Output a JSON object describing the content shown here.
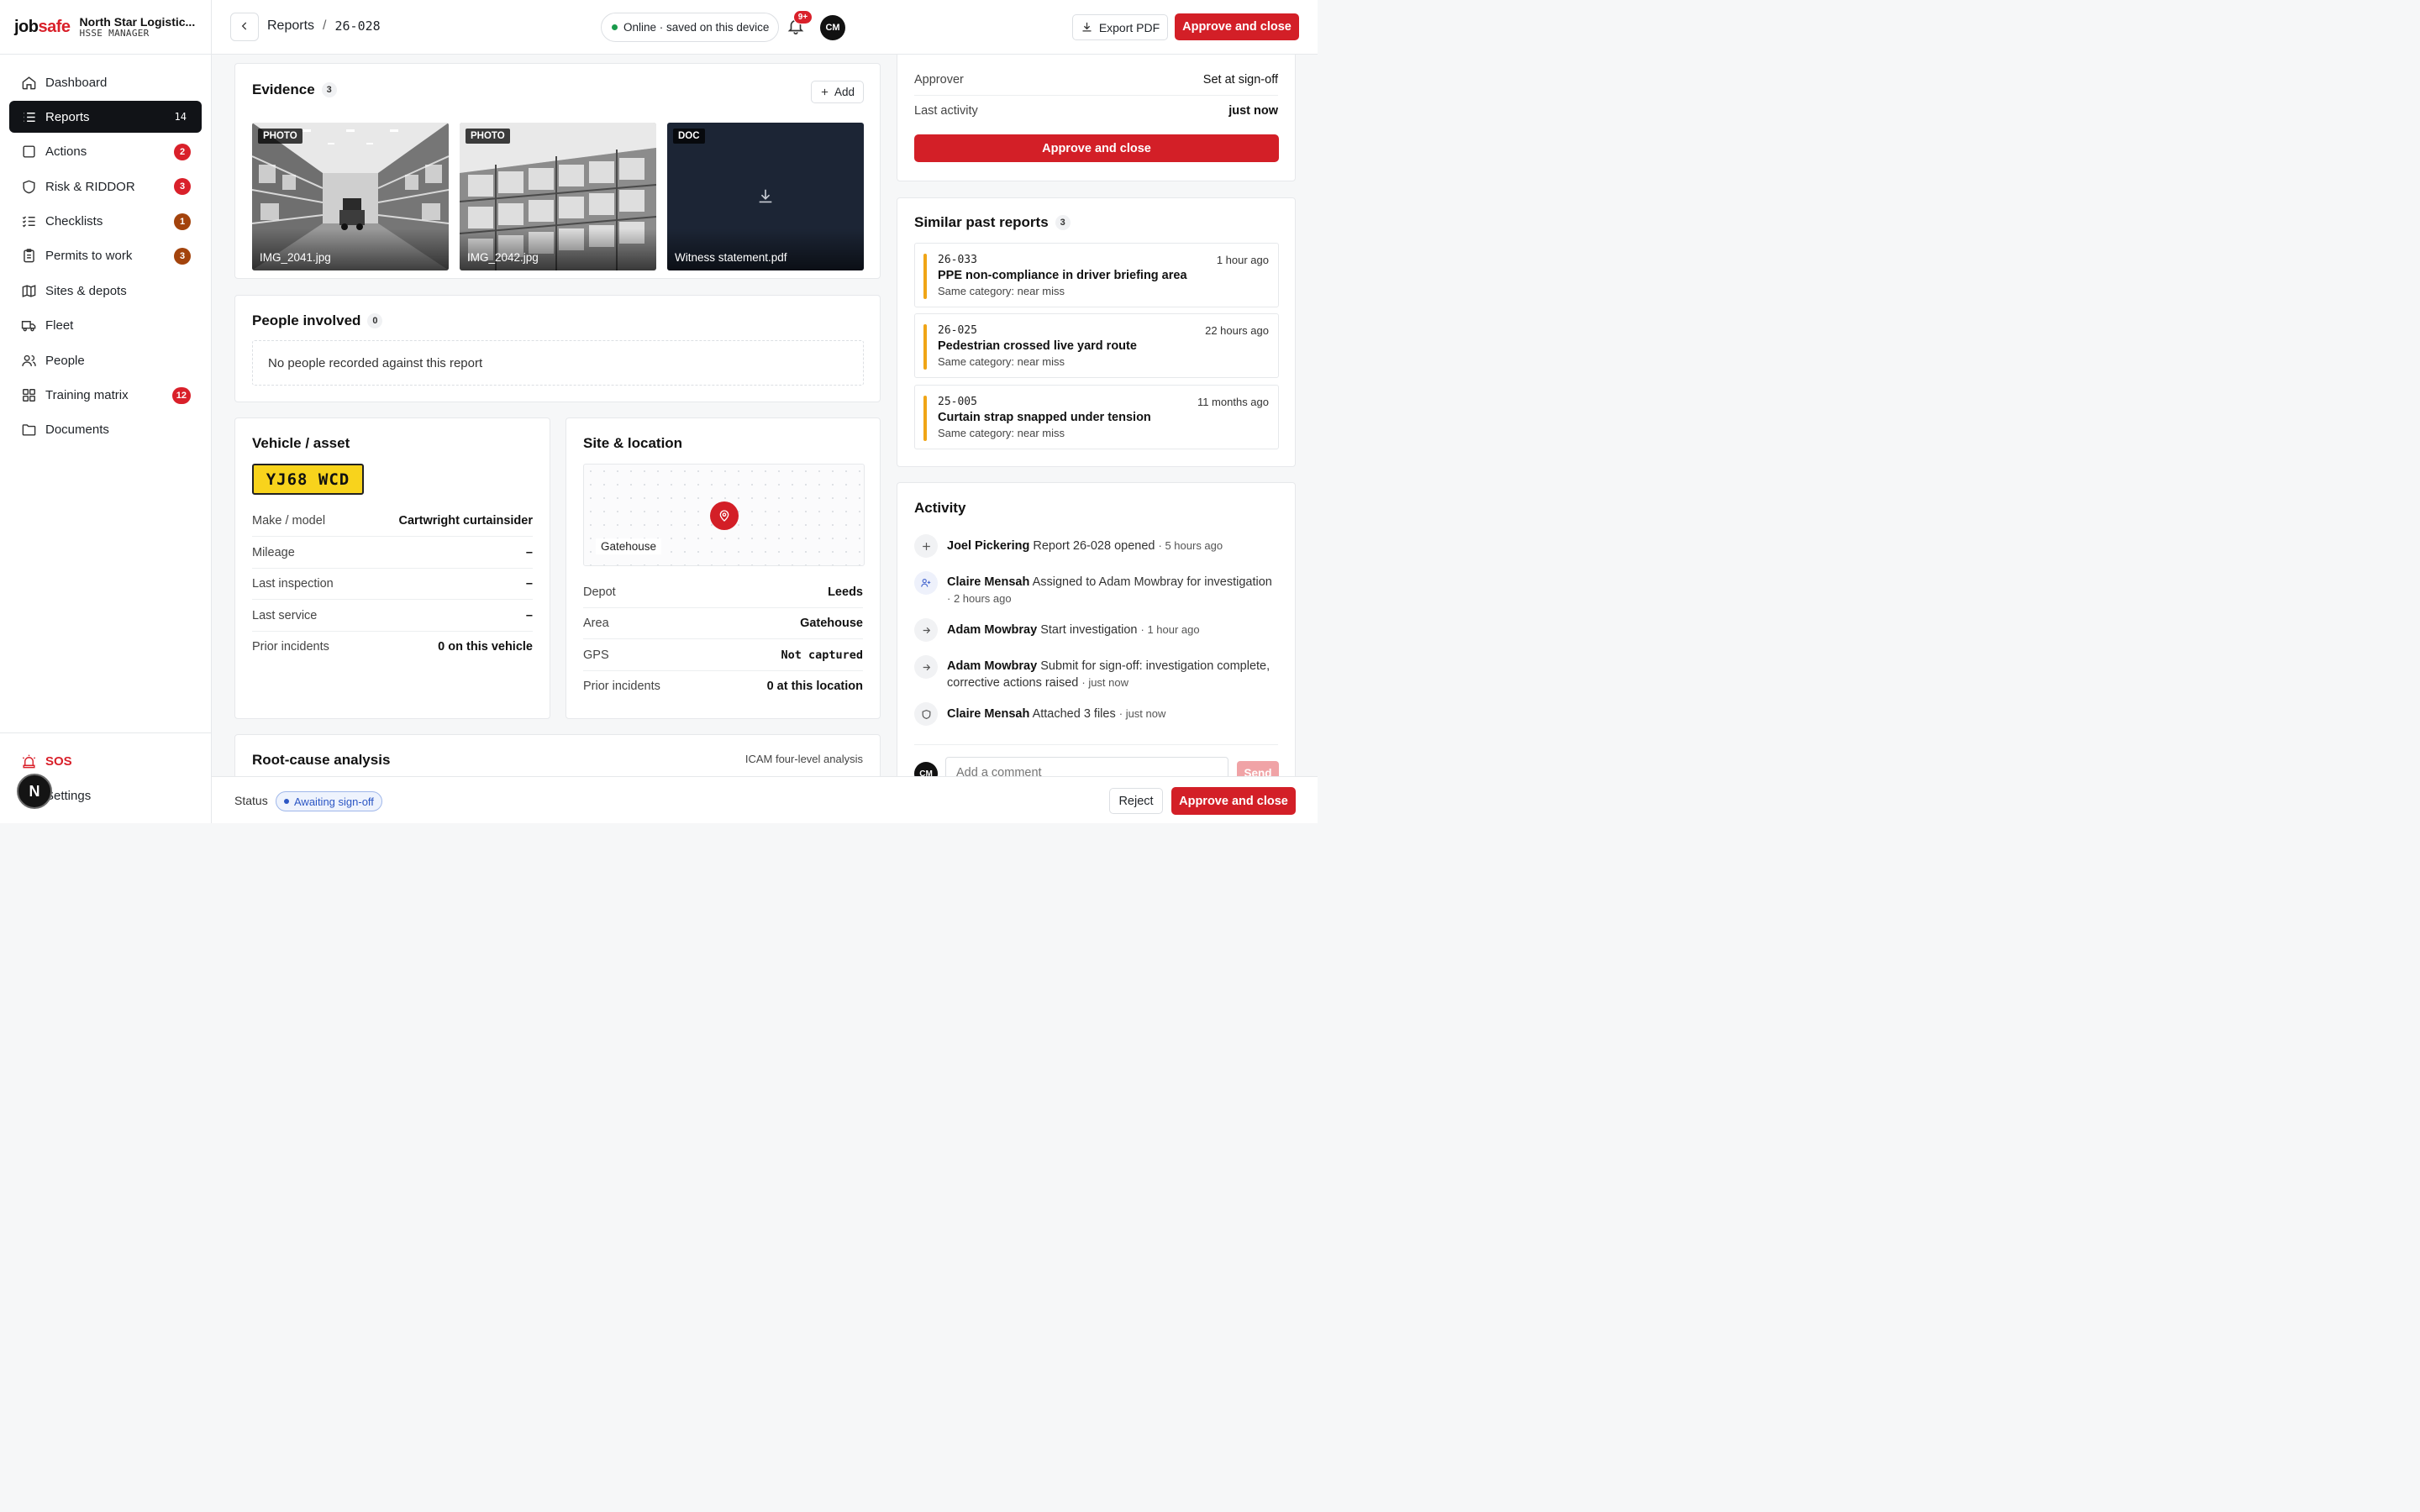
{
  "brand": {
    "logo_main": "job",
    "logo_accent": "safe",
    "org_name": "North Star Logistic...",
    "org_role": "HSSE MANAGER"
  },
  "nav": [
    {
      "label": "Dashboard",
      "icon": "home-icon",
      "badge": ""
    },
    {
      "label": "Reports",
      "icon": "list-icon",
      "badge": "14",
      "active": true
    },
    {
      "label": "Actions",
      "icon": "square-icon",
      "badge": "2"
    },
    {
      "label": "Risk & RIDDOR",
      "icon": "shield-icon",
      "badge": "3"
    },
    {
      "label": "Checklists",
      "icon": "checklist-icon",
      "badge": "1"
    },
    {
      "label": "Permits to work",
      "icon": "clipboard-icon",
      "badge": "3"
    },
    {
      "label": "Sites & depots",
      "icon": "map-icon",
      "badge": ""
    },
    {
      "label": "Fleet",
      "icon": "truck-icon",
      "badge": ""
    },
    {
      "label": "People",
      "icon": "people-icon",
      "badge": ""
    },
    {
      "label": "Training matrix",
      "icon": "grid-icon",
      "badge": "12"
    },
    {
      "label": "Documents",
      "icon": "folder-icon",
      "badge": ""
    }
  ],
  "sidebar_bottom": {
    "sos": "SOS",
    "settings": "Settings",
    "fab": "N"
  },
  "topbar": {
    "crumb_section": "Reports",
    "crumb_sep": "/",
    "crumb_id": "26-028",
    "status": "Online · saved on this device",
    "bell_badge": "9+",
    "avatar": "CM",
    "export": "Export PDF",
    "approve": "Approve and close"
  },
  "evidence": {
    "title": "Evidence",
    "count": "3",
    "add": "Add",
    "tiles": [
      {
        "kind": "PHOTO",
        "name": "IMG_2041.jpg"
      },
      {
        "kind": "PHOTO",
        "name": "IMG_2042.jpg"
      },
      {
        "kind": "DOC",
        "name": "Witness statement.pdf"
      }
    ]
  },
  "people": {
    "title": "People involved",
    "count": "0",
    "empty": "No people recorded against this report"
  },
  "vehicle": {
    "title": "Vehicle / asset",
    "plate": "YJ68 WCD",
    "rows": [
      {
        "k": "Make / model",
        "v": "Cartwright curtainsider"
      },
      {
        "k": "Mileage",
        "v": "–"
      },
      {
        "k": "Last inspection",
        "v": "–"
      },
      {
        "k": "Last service",
        "v": "–"
      },
      {
        "k": "Prior incidents",
        "v": "0 on this vehicle"
      }
    ]
  },
  "site": {
    "title": "Site & location",
    "map_label": "Gatehouse",
    "rows": [
      {
        "k": "Depot",
        "v": "Leeds"
      },
      {
        "k": "Area",
        "v": "Gatehouse"
      },
      {
        "k": "GPS",
        "v": "Not captured"
      },
      {
        "k": "Prior incidents",
        "v": "0 at this location"
      }
    ]
  },
  "rca": {
    "title": "Root-cause analysis",
    "method": "ICAM four-level analysis"
  },
  "summary": {
    "rows": [
      {
        "k": "Approver",
        "v": "Set at sign-off"
      },
      {
        "k": "Last activity",
        "v": "just now"
      }
    ],
    "approve": "Approve and close"
  },
  "similar": {
    "title": "Similar past reports",
    "count": "3",
    "items": [
      {
        "id": "26-033",
        "time": "1 hour ago",
        "title": "PPE non-compliance in driver briefing area",
        "category": "Same category: near miss"
      },
      {
        "id": "26-025",
        "time": "22 hours ago",
        "title": "Pedestrian crossed live yard route",
        "category": "Same category: near miss"
      },
      {
        "id": "25-005",
        "time": "11 months ago",
        "title": "Curtain strap snapped under tension",
        "category": "Same category: near miss"
      }
    ]
  },
  "activity": {
    "title": "Activity",
    "items": [
      {
        "icon": "plus-icon",
        "who": "Joel Pickering",
        "what": "Report 26-028 opened",
        "when": "· 5 hours ago"
      },
      {
        "icon": "user-plus-icon",
        "who": "Claire Mensah",
        "what": "Assigned to Adam Mowbray for investigation",
        "when": "· 2 hours ago"
      },
      {
        "icon": "arrow-right-icon",
        "who": "Adam Mowbray",
        "what": "Start investigation",
        "when": "· 1 hour ago"
      },
      {
        "icon": "arrow-right-icon",
        "who": "Adam Mowbray",
        "what": "Submit for sign-off: investigation complete, corrective actions raised",
        "when": "· just now"
      },
      {
        "icon": "shield-icon",
        "who": "Claire Mensah",
        "what": "Attached 3 files",
        "when": "· just now"
      }
    ],
    "comment_avatar": "CM",
    "comment_placeholder": "Add a comment",
    "send": "Send"
  },
  "bottombar": {
    "status_label": "Status",
    "status": "Awaiting sign-off",
    "reject": "Reject",
    "approve": "Approve and close"
  }
}
